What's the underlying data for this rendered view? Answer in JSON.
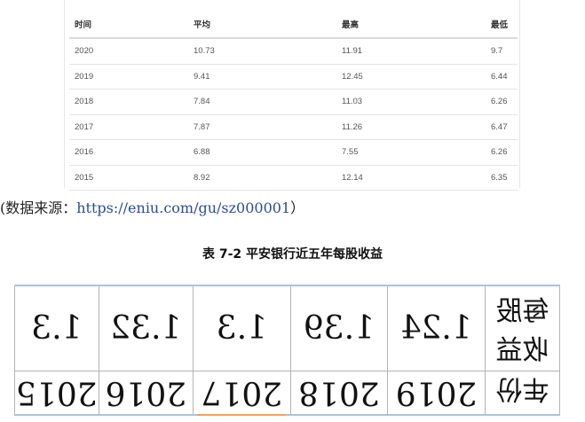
{
  "top_table": {
    "headers": [
      "时间",
      "平均",
      "最高",
      "最低"
    ],
    "rows": [
      [
        "2020",
        "10.73",
        "11.91",
        "9.7"
      ],
      [
        "2019",
        "9.41",
        "12.45",
        "6.44"
      ],
      [
        "2018",
        "7.84",
        "11.03",
        "6.26"
      ],
      [
        "2017",
        "7.87",
        "11.26",
        "6.47"
      ],
      [
        "2016",
        "6.88",
        "7.55",
        "6.26"
      ],
      [
        "2015",
        "8.92",
        "12.14",
        "6.35"
      ]
    ]
  },
  "source": {
    "prefix": "(数据来源：",
    "url": "https://eniu.com/gu/sz000001",
    "suffix": "）"
  },
  "caption": "表 7-2 平安银行近五年每股收益",
  "eps_table": {
    "row1_header": "每股收益",
    "row1_values": [
      "1.3",
      "1.32",
      "1.3",
      "1.39",
      "1.24"
    ],
    "row2_header": "年份",
    "row2_values": [
      "2015",
      "2016",
      "2017",
      "2018",
      "2019"
    ]
  }
}
